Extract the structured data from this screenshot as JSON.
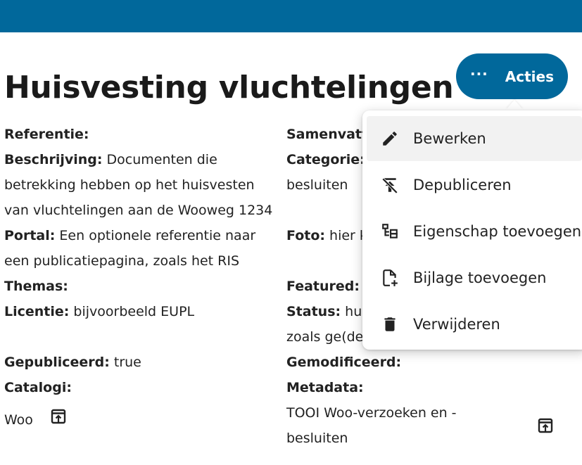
{
  "header": {
    "brand_color": "#01689b"
  },
  "page": {
    "title": "Huisvesting vluchtelingen"
  },
  "actions_button": {
    "label": "Acties",
    "dots": "···",
    "icon": "more-horizontal-icon"
  },
  "menu": {
    "items": [
      {
        "label": "Bewerken",
        "icon": "pencil-icon"
      },
      {
        "label": "Depubliceren",
        "icon": "unpublish-icon"
      },
      {
        "label": "Eigenschap toevoegen",
        "icon": "add-property-icon"
      },
      {
        "label": "Bijlage toevoegen",
        "icon": "file-plus-icon"
      },
      {
        "label": "Verwijderen",
        "icon": "trash-icon"
      }
    ]
  },
  "details": {
    "left": {
      "referentie_label": "Referentie:",
      "beschrijving_label": "Beschrijving:",
      "beschrijving_line1": " Documenten die",
      "beschrijving_line2": "betrekking hebben op het huisvesten",
      "beschrijving_line3": "van vluchtelingen aan de Wooweg 1234",
      "portal_label": "Portal:",
      "portal_line1": " Een optionele referentie naar",
      "portal_line2": "een publicatiepagina, zoals het RIS",
      "themas_label": "Themas:",
      "licentie_label": "Licentie:",
      "licentie_value": " bijvoorbeeld EUPL",
      "gepubliceerd_label": "Gepubliceerd:",
      "gepubliceerd_value": " true",
      "catalogi_label": "Catalogi:",
      "catalogi_value": "Woo",
      "catalogi_icon": "open-in-new-icon"
    },
    "right": {
      "samenvatting_label": "Samenvatt",
      "categorie_label": "Categorie:",
      "categorie_line2": "besluiten",
      "foto_label": "Foto:",
      "foto_value": " hier k",
      "featured_label": "Featured:",
      "status_label": "Status:",
      "status_value": " hui",
      "status_line2": "zoals ge(de",
      "gemodificeerd_label": "Gemodificeerd:",
      "metadata_label": "Metadata:",
      "metadata_line1": "TOOI Woo-verzoeken en -",
      "metadata_line2": "besluiten",
      "metadata_icon": "open-in-new-icon"
    }
  }
}
